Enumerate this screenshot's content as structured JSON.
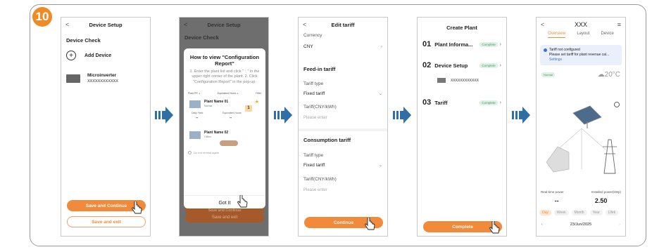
{
  "step_number": "10",
  "screen1": {
    "title": "Device Setup",
    "back": "<",
    "section": "Device Check",
    "add_device": "Add Device",
    "device_name": "Microinverter",
    "device_serial": "XXXXXXXXXXXX",
    "save_continue": "Save and Continue",
    "save_exit": "Save and exit"
  },
  "screen2": {
    "title": "Device Setup",
    "section": "Device Check",
    "modal_title": "How to view \"Configuration Report\"",
    "modal_steps": "1. Enter the plant list and click \"⋮\" in the upper right corner of the plant. 2. Click \"Configuration Report\" in the pop-up.",
    "list_header_1": "Plant PR ⇣",
    "list_header_2": "Equivalent Hours ⇣",
    "list_header_3": "Filter",
    "plant1_name": "Plant Name 01",
    "plant1_status": "Normal",
    "plant1_daily": "Daily Yield",
    "plant1_eq": "Equivalent Hours",
    "plant1_val1": "--",
    "plant1_val2": "--",
    "callout_num": "1",
    "plant2_name": "Plant Name 02",
    "plant2_status": "Offline",
    "no_remind": "Do not remind again",
    "got_it": "Got It",
    "bg_btn1": "Save and Continue",
    "bg_btn2": "Save and exit"
  },
  "screen3": {
    "title": "Edit tariff",
    "back": "<",
    "currency_label": "Currency",
    "currency_value": "CNY",
    "feedin_section": "Feed-in tariff",
    "tariff_type_label": "Tariff type",
    "tariff_type_value": "Fixed tariff",
    "tariff_label": "Tariff(CNY/kWh)",
    "tariff_placeholder": "Please enter",
    "consumption_section": "Consumption tariff",
    "tariff_type_label2": "Tariff type",
    "tariff_type_value2": "Fixed tariff",
    "tariff_label2": "Tariff(CNY/kWh)",
    "tariff_placeholder2": "Please enter",
    "continue": "Continue"
  },
  "screen4": {
    "title": "Create Plant",
    "step1_num": "01",
    "step1_label": "Plant Informa...",
    "step2_num": "02",
    "step2_label": "Device Setup",
    "device_serial": "XXXXXXXXXXXX",
    "step3_num": "03",
    "step3_label": "Tariff",
    "complete_chip": "Complete",
    "complete_btn": "Complete"
  },
  "screen5": {
    "title": "XXX",
    "back": "<",
    "tabs": [
      "Overview",
      "Layout",
      "Device"
    ],
    "notice_title": "Tariff not configured",
    "notice_body": "Please set tariff for plant revenue cal...",
    "notice_link": "Settings",
    "status": "Normal",
    "temperature": "20°C",
    "realtime_label": "Real-time power",
    "installed_label": "Installed power(kWp)",
    "realtime_value": "--",
    "installed_value": "2.50",
    "periods": [
      "Day",
      "Week",
      "Month",
      "Year",
      "Lifeti"
    ],
    "date": "23/Jun/2025"
  },
  "colors": {
    "accent": "#f28a3b",
    "arrow": "#2f6fa5",
    "green": "#4a9d5f",
    "blue": "#3b6fd8"
  }
}
